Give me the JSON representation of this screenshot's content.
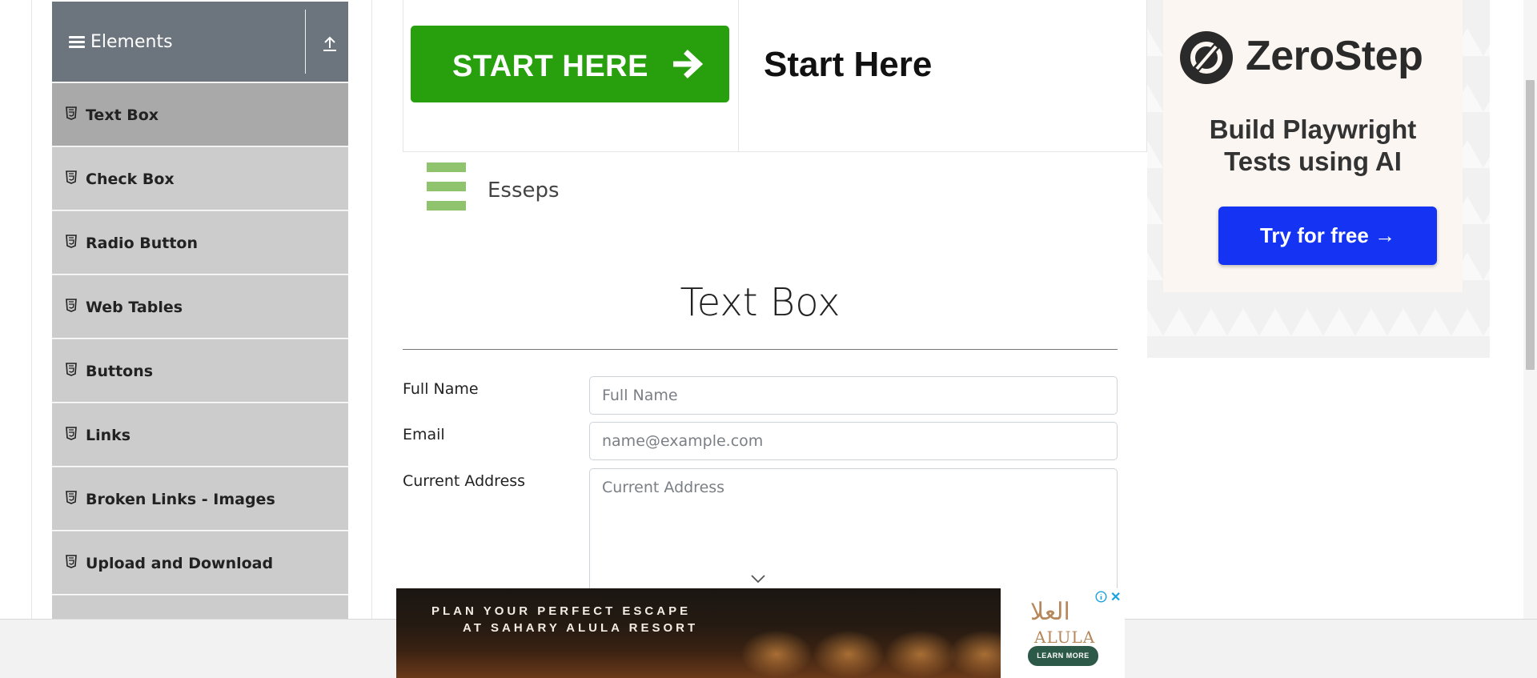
{
  "sidebar": {
    "group_title": "Elements",
    "items": [
      {
        "label": "Text Box"
      },
      {
        "label": "Check Box"
      },
      {
        "label": "Radio Button"
      },
      {
        "label": "Web Tables"
      },
      {
        "label": "Buttons"
      },
      {
        "label": "Links"
      },
      {
        "label": "Broken Links - Images"
      },
      {
        "label": "Upload and Download"
      }
    ],
    "active_item": "Text Box"
  },
  "banner": {
    "button_label": "START HERE",
    "heading": "Start Here",
    "button_color": "#28a00e"
  },
  "logo": {
    "text": "Esseps"
  },
  "form": {
    "title": "Text Box",
    "full_name": {
      "label": "Full Name",
      "placeholder": "Full Name"
    },
    "email": {
      "label": "Email",
      "placeholder": "name@example.com"
    },
    "address": {
      "label": "Current Address",
      "placeholder": "Current Address"
    }
  },
  "ad_right": {
    "brand": "ZeroStep",
    "tagline_line1": "Build Playwright",
    "tagline_line2": "Tests using AI",
    "cta": "Try for free →",
    "cta_color": "#1433f2"
  },
  "ad_bottom": {
    "line1": "PLAN YOUR PERFECT ESCAPE",
    "line2": "AT SAHARY ALULA RESORT",
    "brand_arabic": "العلا",
    "brand": "ALULA",
    "cta": "LEARN MORE"
  }
}
